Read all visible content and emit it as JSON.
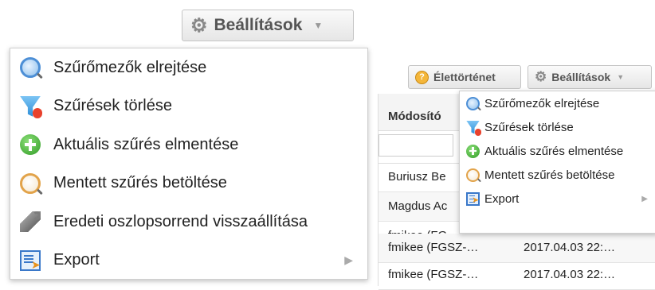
{
  "top_settings_button": {
    "label": "Beállítások",
    "icon": "gear-icon",
    "caret": "▼"
  },
  "big_menu": {
    "items": [
      {
        "label": "Szűrőmezők elrejtése",
        "icon": "magnifier-icon"
      },
      {
        "label": "Szűrések törlése",
        "icon": "filter-clear-icon"
      },
      {
        "label": "Aktuális szűrés elmentése",
        "icon": "add-circle-icon"
      },
      {
        "label": "Mentett szűrés betöltése",
        "icon": "magnifier-orange-icon"
      },
      {
        "label": "Eredeti oszlopsorrend visszaállítása",
        "icon": "wrench-icon"
      },
      {
        "label": "Export",
        "icon": "export-icon",
        "submenu": "▶"
      }
    ]
  },
  "toolbar": {
    "history_label": "Élettörténet",
    "history_icon": "history-icon",
    "settings_label": "Beállítások",
    "settings_caret": "▼"
  },
  "small_menu": {
    "items": [
      {
        "label": "Szűrőmezők elrejtése",
        "icon": "magnifier-icon"
      },
      {
        "label": "Szűrések törlése",
        "icon": "filter-clear-icon"
      },
      {
        "label": "Aktuális szűrés elmentése",
        "icon": "add-circle-icon"
      },
      {
        "label": "Mentett szűrés betöltése",
        "icon": "magnifier-orange-icon"
      },
      {
        "label": "Export",
        "icon": "export-icon",
        "submenu": "▶"
      }
    ]
  },
  "table": {
    "header_modifier": "Módosító",
    "rows": [
      {
        "modifier": "Buriusz Be",
        "date": ""
      },
      {
        "modifier": "Magdus Ac",
        "date": ""
      },
      {
        "modifier": "fmikee (FG",
        "date": ""
      },
      {
        "modifier": "fmikee (FGSZ-…",
        "date": "2017.04.03 22:…"
      },
      {
        "modifier": "fmikee (FGSZ-…",
        "date": "2017.04.03 22:…"
      }
    ]
  },
  "colors": {
    "accent_blue": "#4d8fd6",
    "menu_border": "#d0d0d0"
  }
}
